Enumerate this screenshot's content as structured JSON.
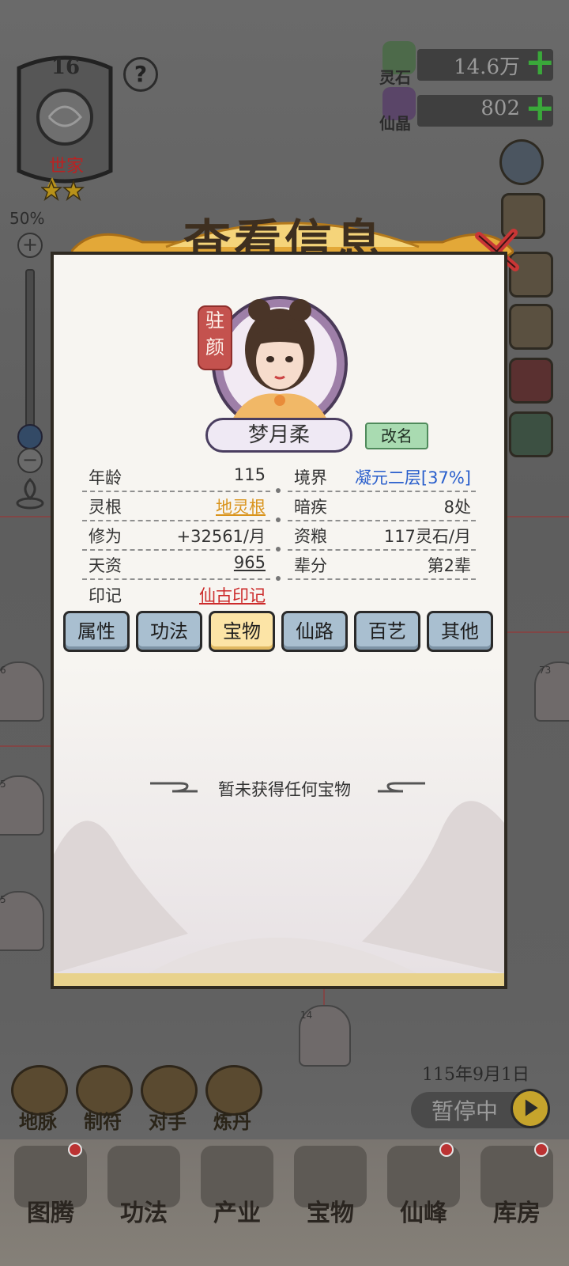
{
  "hud": {
    "rank_number": "16",
    "rank_label": "世家",
    "help": "?",
    "zoom_percent": "50%",
    "zoom_plus": "+",
    "zoom_minus": "−",
    "currencies": [
      {
        "label": "灵石",
        "value": "14.6万",
        "plus": "+"
      },
      {
        "label": "仙晶",
        "value": "802",
        "plus": "+"
      }
    ]
  },
  "modal": {
    "title": "查看信息",
    "seal_text": "驻颜",
    "name": "梦月柔",
    "rename_label": "改名",
    "stats_left": [
      {
        "label": "年龄",
        "value": "115"
      },
      {
        "label": "灵根",
        "value": "地灵根"
      },
      {
        "label": "修为",
        "value": "+32561/月"
      },
      {
        "label": "天资",
        "value": "965"
      },
      {
        "label": "印记",
        "value": "仙古印记"
      }
    ],
    "stats_right": [
      {
        "label": "境界",
        "value": "凝元二层[37%]"
      },
      {
        "label": "暗疾",
        "value": "8处"
      },
      {
        "label": "资粮",
        "value": "117灵石/月"
      },
      {
        "label": "辈分",
        "value": "第2辈"
      }
    ],
    "tabs": [
      "属性",
      "功法",
      "宝物",
      "仙路",
      "百艺",
      "其他"
    ],
    "active_tab": "宝物",
    "empty_message": "暂未获得任何宝物"
  },
  "world": {
    "date": "115年9月1日",
    "pause_label": "暂停中",
    "tools": [
      "地脉",
      "制符",
      "对手",
      "炼丹"
    ],
    "char_badges": [
      "6",
      "5",
      "5",
      "73",
      "14"
    ]
  },
  "nav": {
    "items": [
      "图腾",
      "功法",
      "产业",
      "宝物",
      "仙峰",
      "库房"
    ]
  },
  "colors": {
    "gold_link": "#d9931b",
    "red_link": "#cc2b2b",
    "realm_blue": "#2a5fcc",
    "tab_active": "#fce4a6",
    "tab_default": "#a9bfd0",
    "rename_green": "#a9dbb1"
  }
}
